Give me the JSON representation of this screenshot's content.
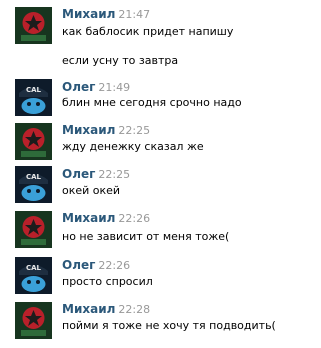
{
  "messages": [
    {
      "author": "Михаил",
      "time": "21:47",
      "lines": [
        "как баблосик придет напишу",
        "если усну то завтра"
      ],
      "avatar": "mikhail"
    },
    {
      "author": "Олег",
      "time": "21:49",
      "lines": [
        "блин мне сегодня срочно надо"
      ],
      "avatar": "oleg"
    },
    {
      "author": "Михаил",
      "time": "22:25",
      "lines": [
        "жду денежку сказал же"
      ],
      "avatar": "mikhail"
    },
    {
      "author": "Олег",
      "time": "22:25",
      "lines": [
        "окей окей"
      ],
      "avatar": "oleg"
    },
    {
      "author": "Михаил",
      "time": "22:26",
      "lines": [
        "но не зависит от меня тоже("
      ],
      "avatar": "mikhail"
    },
    {
      "author": "Олег",
      "time": "22:26",
      "lines": [
        "просто спросил"
      ],
      "avatar": "oleg"
    },
    {
      "author": "Михаил",
      "time": "22:28",
      "lines": [
        "пойми я тоже не хочу тя подводить("
      ],
      "avatar": "mikhail"
    }
  ],
  "colors": {
    "author_name": "#2b587a",
    "timestamp": "#999999",
    "text": "#000000"
  },
  "avatar_styles": {
    "mikhail": {
      "icon": "red-emblem-avatar-icon",
      "bg": "#17351f",
      "accent": "#b9202a"
    },
    "oleg": {
      "icon": "blue-cap-avatar-icon",
      "bg": "#0e1b2a",
      "accent": "#3aa0d8"
    }
  }
}
